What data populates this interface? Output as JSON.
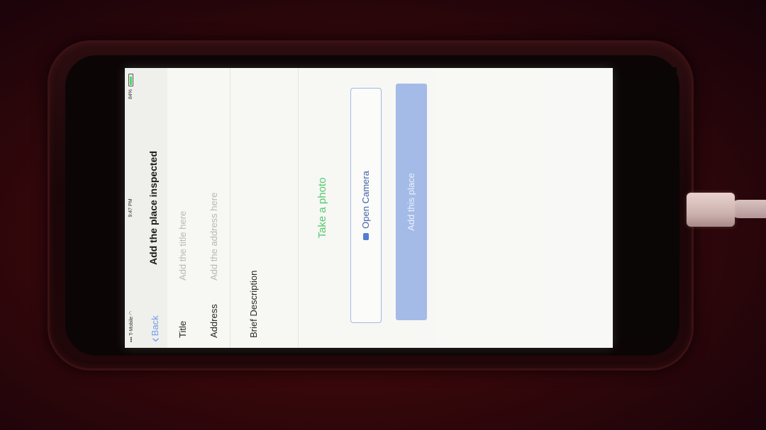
{
  "status_bar": {
    "carrier": "T-Mobile",
    "time": "9:47 PM",
    "battery_percent": "84%",
    "battery_level": 0.84,
    "battery_color": "#4cd964"
  },
  "nav": {
    "back_label": "Back",
    "title": "Add the place inspected"
  },
  "form": {
    "title_label": "Title",
    "title_placeholder": "Add the title here",
    "address_label": "Address",
    "address_placeholder": "Add the address here",
    "description_label": "Brief Description"
  },
  "photo": {
    "heading": "Take a photo",
    "open_camera_label": "Open Camera"
  },
  "submit": {
    "label": "Add this place"
  },
  "colors": {
    "link_blue": "#6f9ee8",
    "green_heading": "#4fc86a",
    "button_blue": "#9fb7e6"
  },
  "icons": [
    "back-chevron-icon",
    "wifi-icon",
    "camera-icon",
    "battery-icon",
    "signal-icon"
  ]
}
